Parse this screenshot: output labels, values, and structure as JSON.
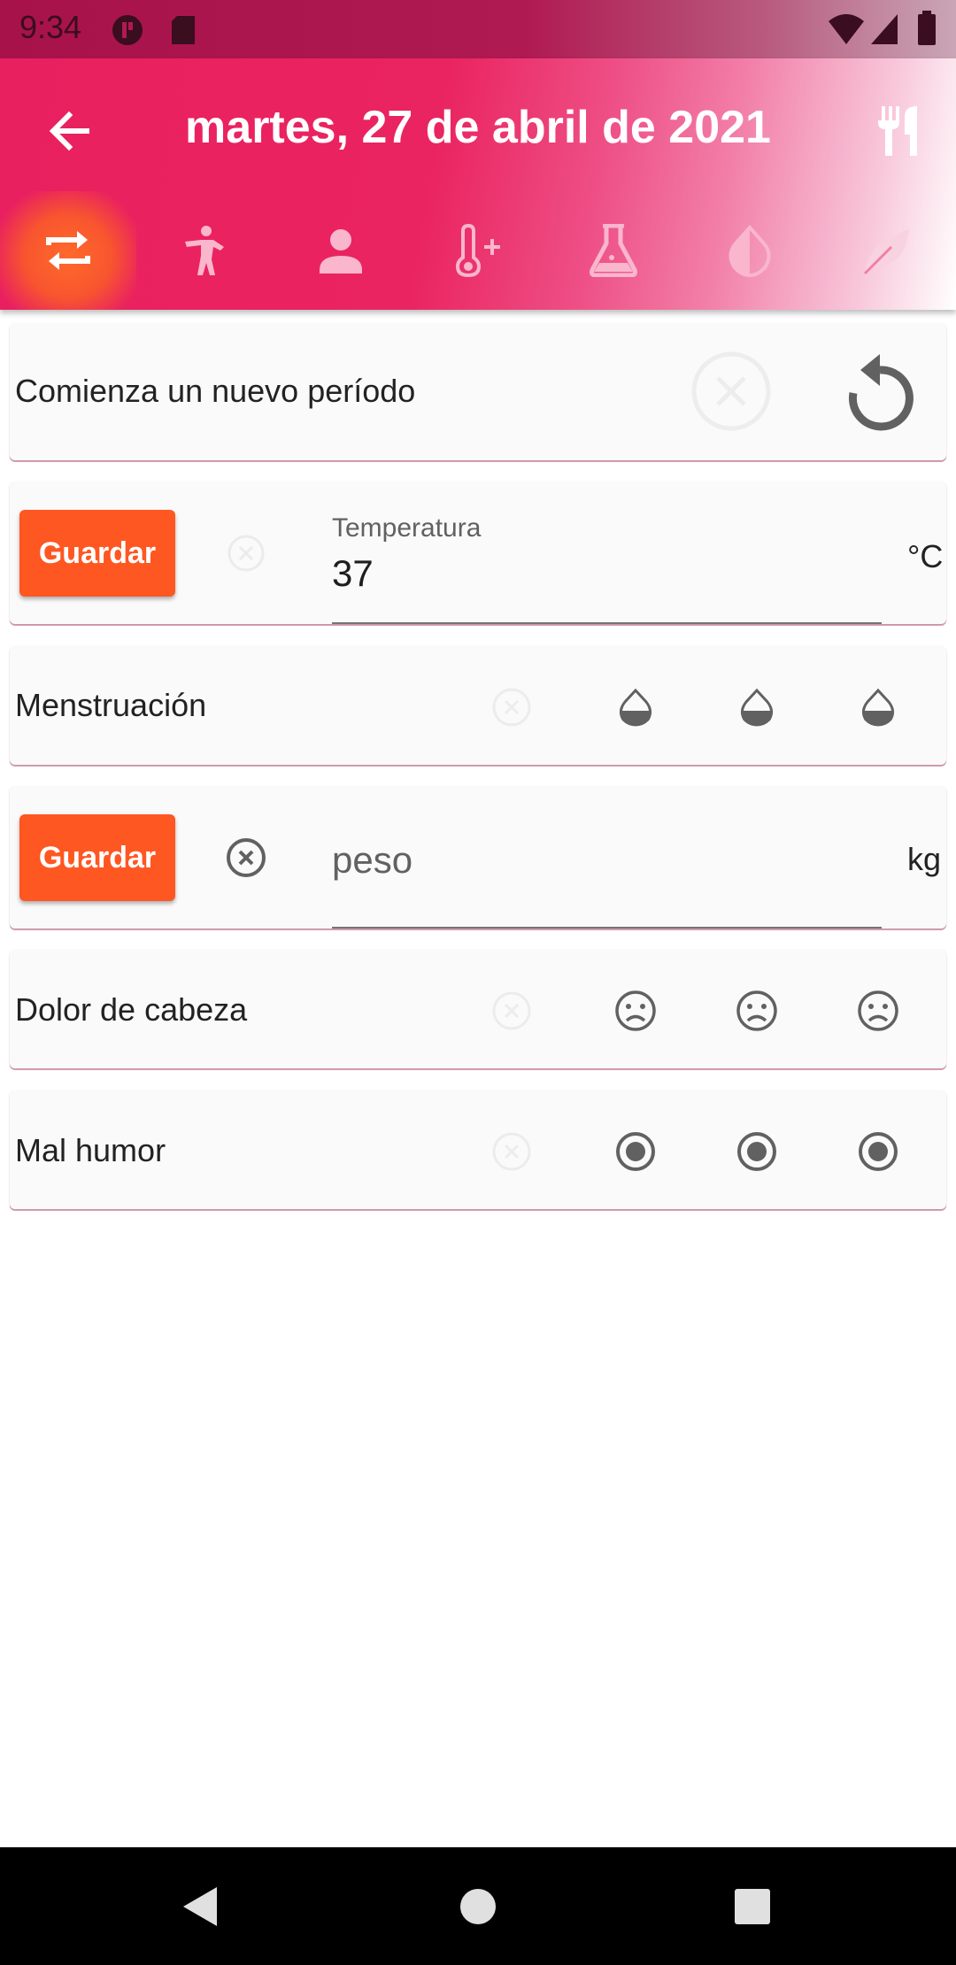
{
  "status_bar": {
    "time": "9:34"
  },
  "app_bar": {
    "title": "martes, 27 de abril de 2021",
    "tabs": [
      "cycle-icon",
      "exercise-icon",
      "person-icon",
      "thermometer-plus-icon",
      "flask-icon",
      "drop-icon",
      "leaf-icon"
    ],
    "accent_color": "#ea2460",
    "active_tab_color": "#ff5722"
  },
  "rows": {
    "period": {
      "label": "Comienza un nuevo período"
    },
    "temperature": {
      "save_label": "Guardar",
      "field_label": "Temperatura",
      "value": "37",
      "unit": "°C"
    },
    "menstruation": {
      "label": "Menstruación"
    },
    "weight": {
      "save_label": "Guardar",
      "placeholder": "peso",
      "unit": "kg"
    },
    "headache": {
      "label": "Dolor de cabeza"
    },
    "bad_mood": {
      "label": "Mal humor"
    }
  },
  "colors": {
    "button": "#ff5722",
    "card_border": "#e6a9c0"
  }
}
